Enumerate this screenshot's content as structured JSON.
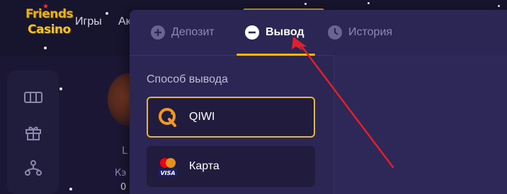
{
  "site": {
    "logo_line1": "Friends",
    "logo_line2": "Casino",
    "nav": [
      "Игры",
      "Ак"
    ],
    "side_partial_text_1": "L",
    "side_partial_text_2": "Кэ",
    "side_partial_text_3": "0"
  },
  "modal": {
    "tabs": [
      {
        "label": "Депозит",
        "icon": "plus-circle-icon",
        "active": false
      },
      {
        "label": "Вывод",
        "icon": "minus-circle-icon",
        "active": true
      },
      {
        "label": "История",
        "icon": "clock-icon",
        "active": false
      }
    ],
    "section_label": "Способ вывода",
    "methods": [
      {
        "label": "QIWI",
        "icon": "qiwi-icon",
        "selected": true
      },
      {
        "label": "Карта",
        "icon": "mastercard-visa-icon",
        "selected": false
      }
    ]
  },
  "colors": {
    "accent": "#e8b823",
    "modal_bg": "#2c2655",
    "page_bg": "#1a1633",
    "annotation_arrow": "#e0202a"
  }
}
